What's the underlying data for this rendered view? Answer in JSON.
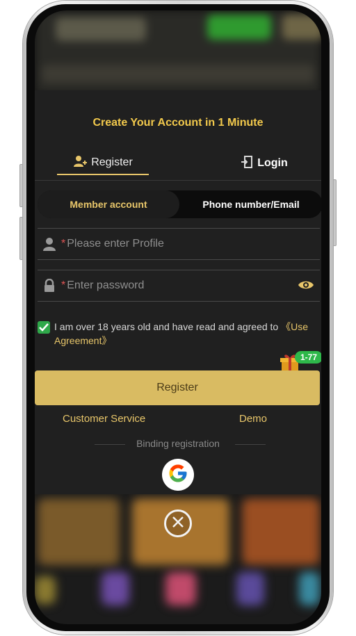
{
  "modal": {
    "title": "Create Your Account in 1 Minute",
    "auth_tabs": [
      {
        "label": "Register",
        "icon": "user-add-icon",
        "active": true
      },
      {
        "label": "Login",
        "icon": "login-door-icon",
        "active": false
      }
    ],
    "account_tabs": [
      {
        "label": "Member account",
        "active": true
      },
      {
        "label": "Phone number/Email",
        "active": false
      }
    ],
    "profile_field": {
      "required_mark": "*",
      "placeholder": "Please enter Profile",
      "icon": "user-icon"
    },
    "password_field": {
      "required_mark": "*",
      "placeholder": "Enter password",
      "icon": "lock-icon",
      "toggle_icon": "eye-icon"
    },
    "agreement": {
      "checked": true,
      "text": "I am over 18 years old and have read and agreed to ",
      "link": "《Use Agreement》"
    },
    "gift_badge": "1-77",
    "register_button": "Register",
    "customer_service": "Customer Service",
    "demo": "Demo",
    "binding_label": "Binding registration",
    "social_icon": "google-icon"
  },
  "close_icon": "close-circle-icon",
  "colors": {
    "accent_gold": "#e8c66a",
    "title_gold": "#f2c94c",
    "button_gold": "#d9bb62",
    "check_green": "#2fa84a",
    "modal_bg": "#202020"
  }
}
